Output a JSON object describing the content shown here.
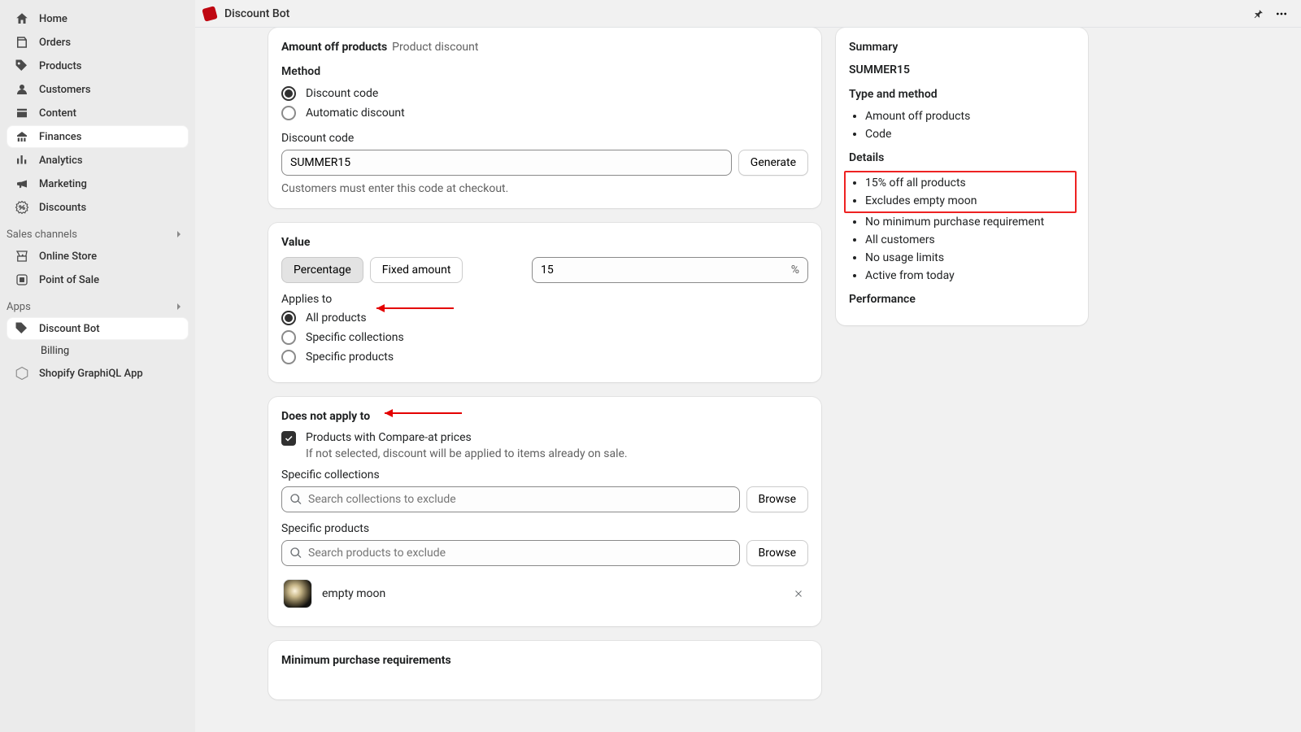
{
  "topbar": {
    "title": "Discount Bot"
  },
  "sidebar": {
    "items": [
      {
        "label": "Home"
      },
      {
        "label": "Orders"
      },
      {
        "label": "Products"
      },
      {
        "label": "Customers"
      },
      {
        "label": "Content"
      },
      {
        "label": "Finances"
      },
      {
        "label": "Analytics"
      },
      {
        "label": "Marketing"
      },
      {
        "label": "Discounts"
      }
    ],
    "sales_channels_title": "Sales channels",
    "sales_channels": [
      {
        "label": "Online Store"
      },
      {
        "label": "Point of Sale"
      }
    ],
    "apps_title": "Apps",
    "apps": [
      {
        "label": "Discount Bot"
      },
      {
        "label": "Billing"
      },
      {
        "label": "Shopify GraphiQL App"
      }
    ]
  },
  "header": {
    "title": "Amount off products",
    "subtitle": "Product discount"
  },
  "method": {
    "section_title": "Method",
    "options": {
      "code": "Discount code",
      "automatic": "Automatic discount"
    },
    "code_label": "Discount code",
    "code_value": "SUMMER15",
    "generate_btn": "Generate",
    "help": "Customers must enter this code at checkout."
  },
  "value": {
    "title": "Value",
    "options": {
      "percentage": "Percentage",
      "fixed": "Fixed amount"
    },
    "amount": "15",
    "unit": "%",
    "applies_to_label": "Applies to",
    "applies_options": {
      "all": "All products",
      "collections": "Specific collections",
      "products": "Specific products"
    }
  },
  "exclude": {
    "title": "Does not apply to",
    "compare_at_label": "Products with Compare-at prices",
    "compare_at_help": "If not selected, discount will be applied to items already on sale.",
    "collections_label": "Specific collections",
    "collections_placeholder": "Search collections to exclude",
    "products_label": "Specific products",
    "products_placeholder": "Search products to exclude",
    "browse_btn": "Browse",
    "excluded_products": [
      {
        "name": "empty moon"
      }
    ]
  },
  "minreq": {
    "title": "Minimum purchase requirements"
  },
  "summary": {
    "title": "Summary",
    "code": "SUMMER15",
    "sections": {
      "type_method": {
        "title": "Type and method",
        "items": [
          "Amount off products",
          "Code"
        ]
      },
      "details": {
        "title": "Details",
        "highlighted": [
          "15% off all products",
          "Excludes empty moon"
        ],
        "rest": [
          "No minimum purchase requirement",
          "All customers",
          "No usage limits",
          "Active from today"
        ]
      },
      "performance": {
        "title": "Performance"
      }
    }
  }
}
